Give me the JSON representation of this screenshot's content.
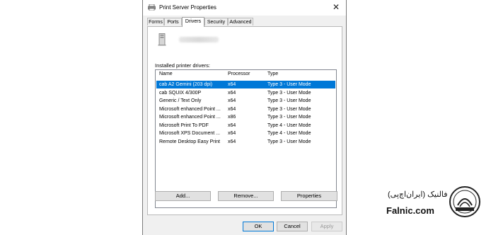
{
  "window": {
    "title": "Print Server Properties"
  },
  "tabs": [
    {
      "label": "Forms"
    },
    {
      "label": "Ports"
    },
    {
      "label": "Drivers"
    },
    {
      "label": "Security"
    },
    {
      "label": "Advanced"
    }
  ],
  "drivers": {
    "installed_label": "Installed printer drivers:",
    "columns": [
      "Name",
      "Processor",
      "Type"
    ],
    "rows": [
      {
        "name": "cab A2 Gemini (203 dpi)",
        "processor": "x64",
        "type": "Type 3 - User Mode",
        "selected": true
      },
      {
        "name": "cab SQUIX 4/300P",
        "processor": "x64",
        "type": "Type 3 - User Mode"
      },
      {
        "name": "Generic / Text Only",
        "processor": "x64",
        "type": "Type 3 - User Mode"
      },
      {
        "name": "Microsoft enhanced Point ...",
        "processor": "x64",
        "type": "Type 3 - User Mode"
      },
      {
        "name": "Microsoft enhanced Point ...",
        "processor": "x86",
        "type": "Type 3 - User Mode"
      },
      {
        "name": "Microsoft Print To PDF",
        "processor": "x64",
        "type": "Type 4 - User Mode"
      },
      {
        "name": "Microsoft XPS Document ...",
        "processor": "x64",
        "type": "Type 4 - User Mode"
      },
      {
        "name": "Remote Desktop Easy Print",
        "processor": "x64",
        "type": "Type 3 - User Mode"
      }
    ]
  },
  "panel_buttons": {
    "add": "Add...",
    "remove": "Remove...",
    "properties": "Properties"
  },
  "footer_buttons": {
    "ok": "OK",
    "cancel": "Cancel",
    "apply": "Apply"
  },
  "watermark": {
    "persian": "فالنیک (ایران‌اچ‌پی)",
    "latin": "Falnic.com"
  },
  "colors": {
    "selection": "#0078d7",
    "dialog_bg": "#f0f0f0"
  },
  "icons": {
    "app": "printer-icon",
    "server": "server-icon",
    "close": "close-icon",
    "logo": "iranhp-logo-icon"
  }
}
